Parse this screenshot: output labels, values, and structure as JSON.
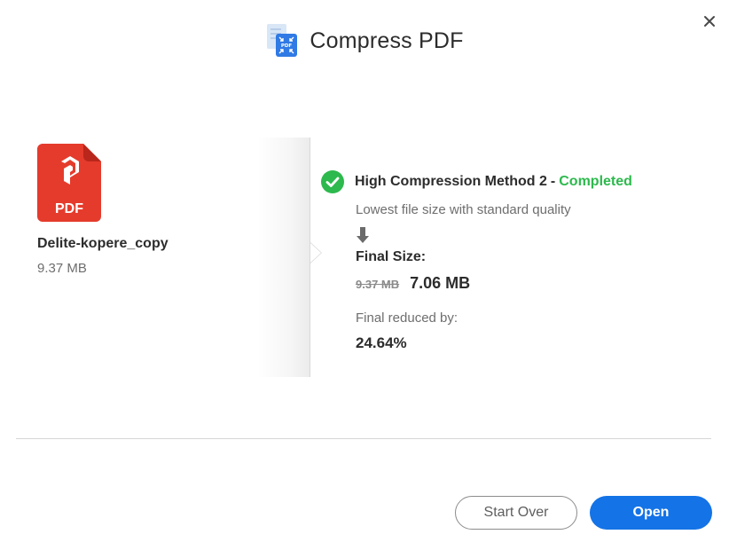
{
  "dialog": {
    "title": "Compress PDF",
    "icons": {
      "header": "compress-pdf-icon",
      "close": "close-icon",
      "file": "pdf-file-icon",
      "status": "check-circle-icon",
      "arrow": "arrow-down-icon"
    }
  },
  "file": {
    "name": "Delite-kopere_copy",
    "size": "9.37 MB",
    "badge": "PDF"
  },
  "result": {
    "method": "High Compression Method 2",
    "separator": "-",
    "status": "Completed",
    "description": "Lowest file size with standard quality",
    "final_size_label": "Final Size:",
    "original_size": "9.37 MB",
    "final_size": "7.06 MB",
    "reduced_label": "Final reduced by:",
    "reduced_value": "24.64%"
  },
  "buttons": {
    "start_over": "Start Over",
    "open": "Open"
  },
  "colors": {
    "accent": "#1473e6",
    "success": "#2db94d",
    "pdf_red": "#e53b2c"
  }
}
